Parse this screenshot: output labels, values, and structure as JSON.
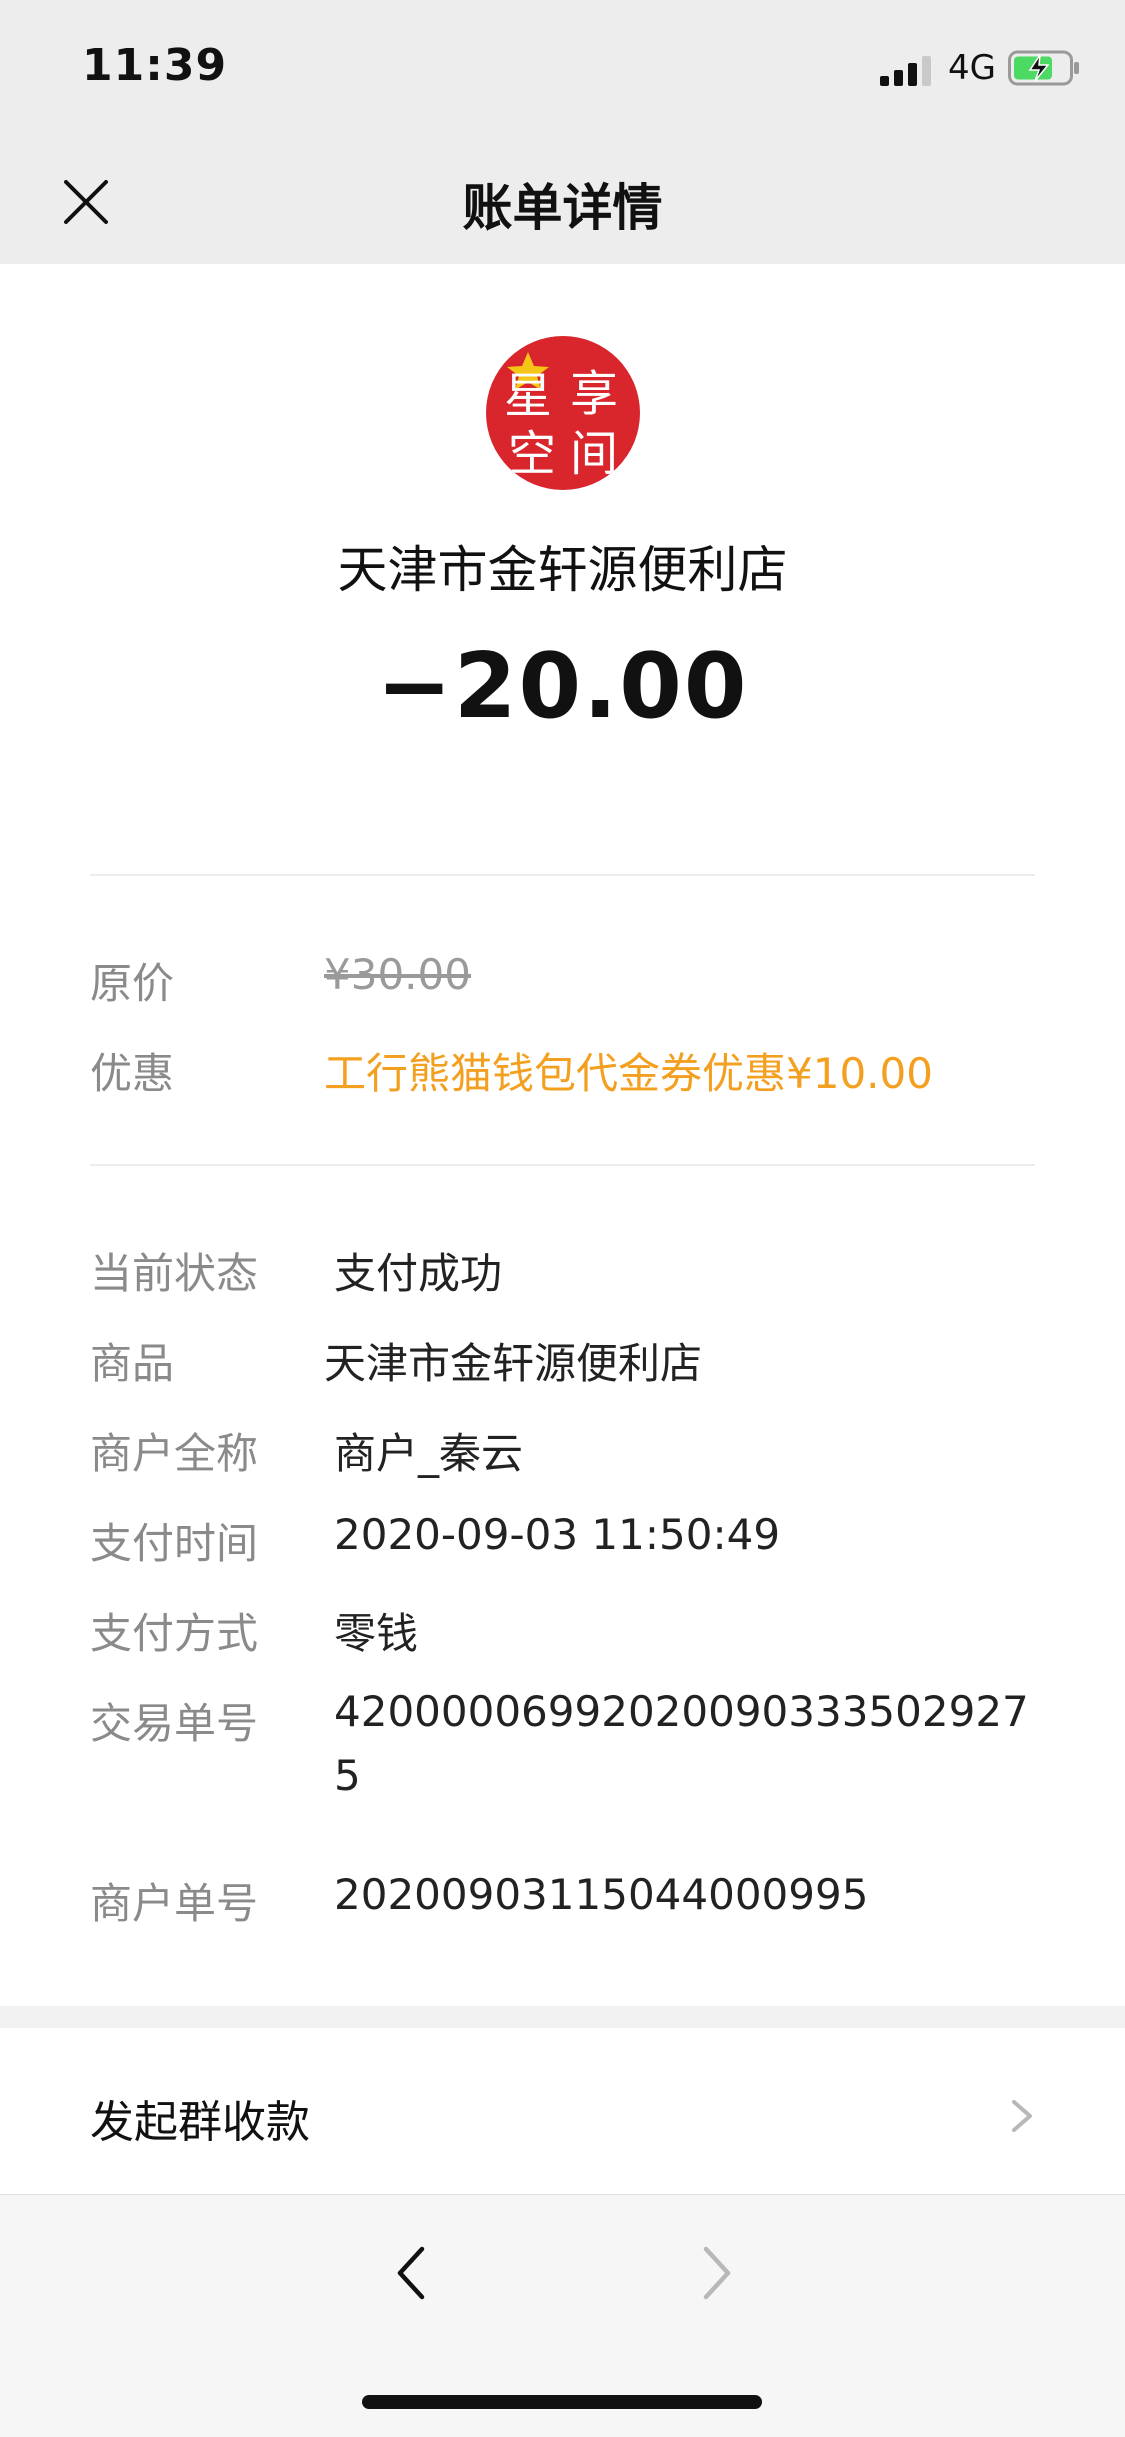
{
  "status_bar": {
    "time": "11:39",
    "network": "4G",
    "signal_icon": "signal-bars-icon",
    "battery_icon": "battery-charging-icon"
  },
  "header": {
    "title": "账单详情",
    "close_icon": "close-icon"
  },
  "summary": {
    "merchant_name": "天津市金轩源便利店",
    "amount": "−20.00",
    "logo_text": [
      "星",
      "享",
      "空",
      "间"
    ],
    "logo_color": "#d8262c"
  },
  "pricing": {
    "original_label": "原价",
    "original_value": "¥30.00",
    "discount_label": "优惠",
    "discount_value": "工行熊猫钱包代金券优惠¥10.00",
    "discount_color": "#f3a021"
  },
  "details": [
    {
      "label": "当前状态",
      "value": "支付成功"
    },
    {
      "label": "商品",
      "value": "天津市金轩源便利店"
    },
    {
      "label": "商户全称",
      "value": "商户_秦云"
    },
    {
      "label": "支付时间",
      "value": "2020-09-03 11:50:49"
    },
    {
      "label": "支付方式",
      "value": "零钱"
    },
    {
      "label": "交易单号",
      "value": "420000069920200903335029275"
    },
    {
      "label": "商户单号",
      "value": "20200903115044000995"
    }
  ],
  "actions": {
    "group_collect_label": "发起群收款",
    "chevron_icon": "chevron-right-icon"
  },
  "bottom_nav": {
    "back_icon": "back-arrow-icon",
    "forward_icon": "forward-arrow-icon"
  }
}
